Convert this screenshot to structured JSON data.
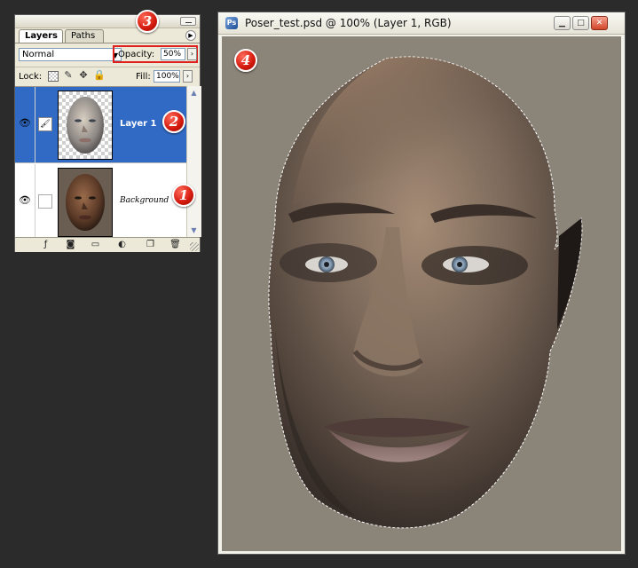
{
  "layers_panel": {
    "tabs": [
      {
        "label": "Layers",
        "active": true
      },
      {
        "label": "Paths",
        "active": false
      }
    ],
    "blend_mode": "Normal",
    "opacity_label": "Opacity:",
    "opacity_value": "50%",
    "lock_label": "Lock:",
    "fill_label": "Fill:",
    "fill_value": "100%",
    "layers": [
      {
        "name": "Layer 1",
        "selected": true,
        "visible": true,
        "thumbnail": "face-transparent"
      },
      {
        "name": "Background",
        "selected": false,
        "visible": true,
        "thumbnail": "face-dark"
      }
    ],
    "footer_icons": [
      "link-layers-icon",
      "add-layer-style-icon",
      "add-mask-icon",
      "new-group-icon",
      "new-adjustment-layer-icon",
      "new-layer-icon",
      "delete-layer-icon"
    ]
  },
  "document": {
    "title": "Poser_test.psd @ 100% (Layer 1, RGB)",
    "canvas_background": "#8b8478"
  },
  "markers": [
    {
      "number": "1",
      "target": "background-layer"
    },
    {
      "number": "2",
      "target": "layer-1"
    },
    {
      "number": "3",
      "target": "opacity-control"
    },
    {
      "number": "4",
      "target": "document-canvas"
    }
  ],
  "colors": {
    "selection_blue": "#316ac5",
    "marker_red": "#d3180c",
    "highlight_box": "#e0201c"
  }
}
